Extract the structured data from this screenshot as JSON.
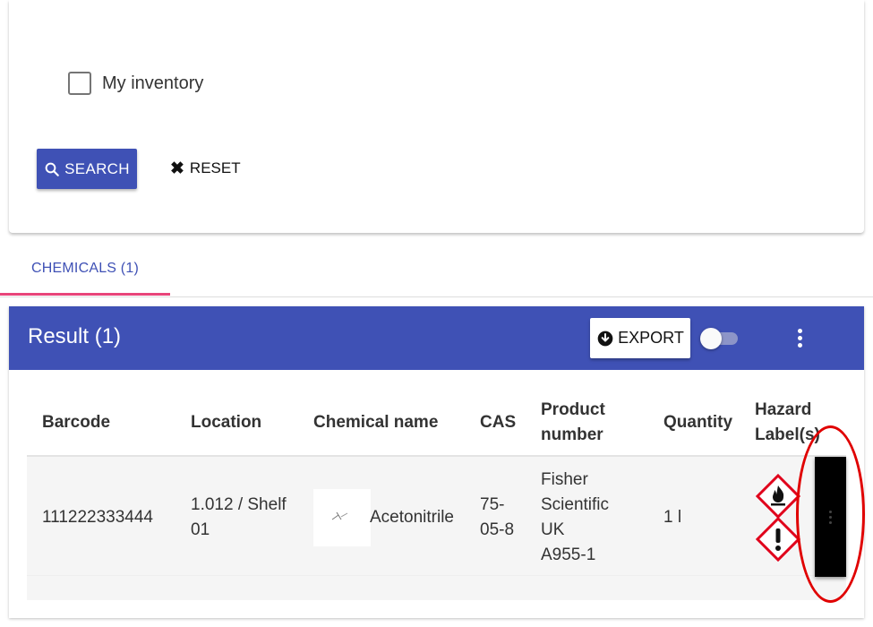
{
  "search": {
    "my_inventory_label": "My inventory",
    "search_label": "SEARCH",
    "reset_label": "RESET"
  },
  "tabs": [
    {
      "label": "CHEMICALS (1)",
      "active": true
    }
  ],
  "result": {
    "title": "Result (1)",
    "export_label": "EXPORT",
    "toggle_on": false
  },
  "table": {
    "headers": {
      "barcode": "Barcode",
      "location": "Location",
      "chemical_name": "Chemical name",
      "cas": "CAS",
      "product_number_1": "Product",
      "product_number_2": "number",
      "quantity": "Quantity",
      "hazard_1": "Hazard",
      "hazard_2": "Label(s)"
    },
    "rows": [
      {
        "barcode": "111222333444",
        "location_1": "1.012 / Shelf",
        "location_2": "01",
        "chemical_name": "Acetonitrile",
        "cas_1": "75-",
        "cas_2": "05-8",
        "product_1": "Fisher",
        "product_2": "Scientific",
        "product_3": "UK",
        "product_4": "A955-1",
        "quantity": "1 l",
        "hazards": [
          "flame-icon",
          "exclamation-icon"
        ]
      }
    ]
  },
  "colors": {
    "primary": "#3f51b5",
    "tab_indicator": "#e8457a",
    "hazard_red": "#e0001b",
    "highlight": "#e00000"
  }
}
